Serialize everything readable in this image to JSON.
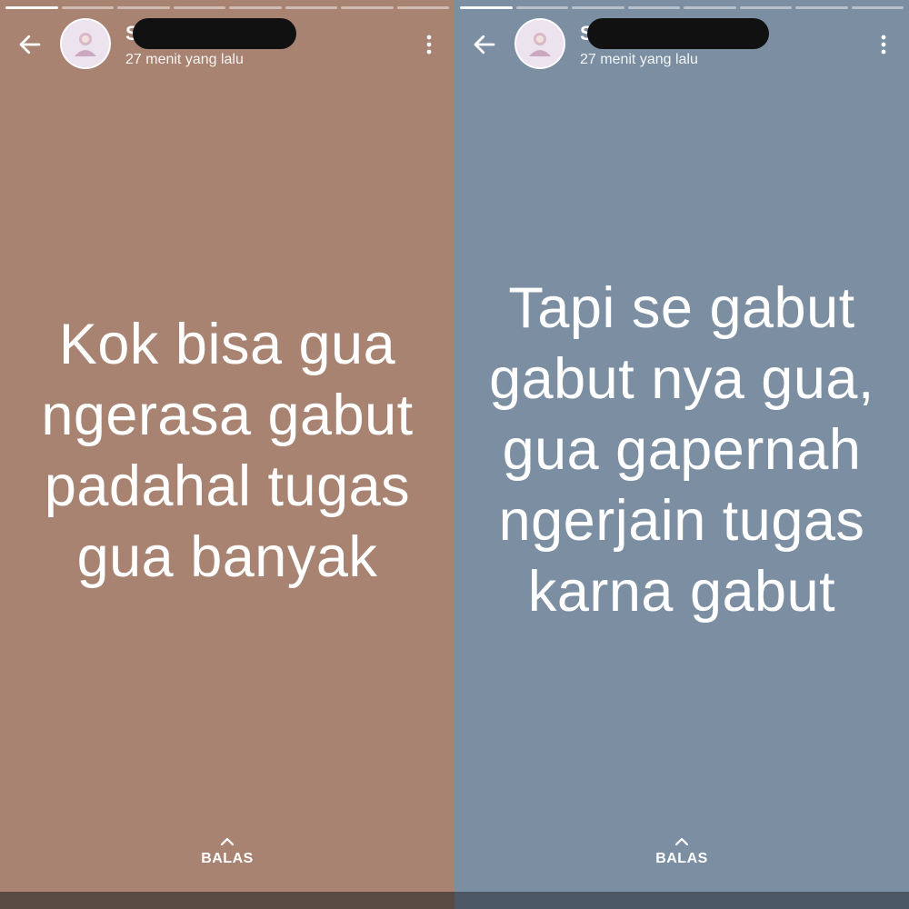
{
  "colors": {
    "left_background": "#a88371",
    "right_background": "#7b8ea2",
    "text": "#ffffff",
    "redaction": "#111111"
  },
  "icons": {
    "back": "arrow-left-icon",
    "more": "more-vertical-icon",
    "reply": "chevron-up-icon"
  },
  "stories": [
    {
      "user_initial": "S",
      "time_ago": "27 menit yang lalu",
      "lines": [
        "Kok bisa gua",
        "ngerasa gabut",
        "padahal tugas",
        "gua banyak"
      ],
      "reply_label": "BALAS",
      "progress_done": 1
    },
    {
      "user_initial": "S",
      "time_ago": "27 menit yang lalu",
      "lines": [
        "Tapi se gabut",
        "gabut nya gua,",
        "gua gapernah",
        "ngerjain tugas",
        "karna gabut"
      ],
      "reply_label": "BALAS",
      "progress_done": 1
    }
  ]
}
